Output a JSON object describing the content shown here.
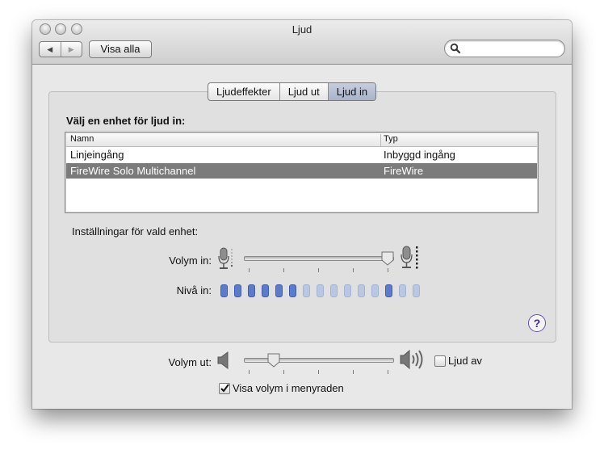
{
  "window": {
    "title": "Ljud"
  },
  "toolbar": {
    "back_icon": "◀",
    "forward_icon": "▶",
    "show_all_label": "Visa alla"
  },
  "search": {
    "placeholder": "",
    "value": ""
  },
  "tabs": [
    {
      "label": "Ljudeffekter",
      "active": false
    },
    {
      "label": "Ljud ut",
      "active": false
    },
    {
      "label": "Ljud in",
      "active": true
    }
  ],
  "input": {
    "section_title": "Välj en enhet för ljud in:",
    "columns": [
      "Namn",
      "Typ"
    ],
    "devices": [
      {
        "name": "Linjeingång",
        "type": "Inbyggd ingång",
        "selected": false
      },
      {
        "name": "FireWire Solo Multichannel",
        "type": "FireWire",
        "selected": true
      }
    ],
    "settings_label": "Inställningar för vald enhet:",
    "volume_label": "Volym in:",
    "volume_level": 0.97,
    "level_label": "Nivå in:",
    "level_bars_total": 15,
    "level_bars_lit": [
      0,
      1,
      2,
      3,
      4,
      5,
      12
    ],
    "help_label": "?"
  },
  "output": {
    "volume_label": "Volym ut:",
    "volume_level": 0.2,
    "mute_label": "Ljud av",
    "mute_checked": false,
    "show_in_menubar_label": "Visa volym i menyraden",
    "show_in_menubar_checked": true
  },
  "colors": {
    "selected_row": "#7b7b7b",
    "meter_on": "#5b7bcc",
    "meter_off": "#b8c8e4",
    "help_ring": "#6a4fa8"
  }
}
